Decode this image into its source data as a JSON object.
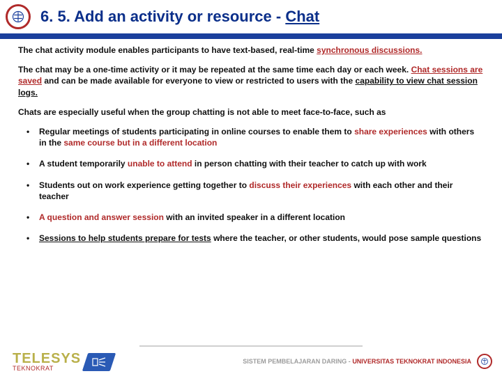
{
  "header": {
    "title_prefix": "6. 5. Add an activity or resource - ",
    "title_chat": "Chat"
  },
  "para1": {
    "a": "The chat activity module enables participants to have text-based, real-time ",
    "b": "synchronous discussions.",
    "c": ""
  },
  "para2": {
    "a": "The chat may be a one-time activity or it may be repeated at the same time each day or each week. ",
    "b": "Chat sessions are saved",
    "c": " and can be made available for everyone to view or restricted to users with the ",
    "d": "capability to view chat session logs."
  },
  "para3": "Chats are especially useful when the group chatting is not able to meet face-to-face, such as",
  "bullets": [
    {
      "a": "Regular meetings of students participating in online courses to enable them to ",
      "b": "share experiences",
      "c": " with others in the ",
      "d": "same course but in a different location"
    },
    {
      "a": "A student temporarily ",
      "b": "unable to attend",
      "c": " in person chatting with their teacher to catch up with work"
    },
    {
      "a": "Students out on work experience getting together to ",
      "b": "discuss their experiences",
      "c": " with each other and their teacher"
    },
    {
      "a": "",
      "b": "A question and answer session",
      "c": " with an invited speaker in a different location"
    },
    {
      "a": "",
      "b": "Sessions to help students prepare for tests",
      "c": " where the teacher, or other students, would pose sample questions"
    }
  ],
  "footer": {
    "telesys": "TELESYS",
    "teknokrat": "TEKNOKRAT",
    "line_grey": "SISTEM PEMBELAJARAN DARING - ",
    "line_red": "UNIVERSITAS TEKNOKRAT INDONESIA"
  }
}
